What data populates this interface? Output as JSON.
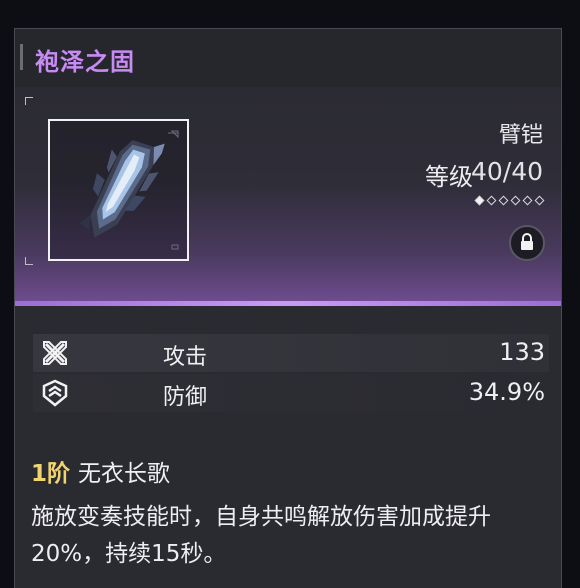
{
  "item": {
    "name": "袍泽之固",
    "type": "臂铠",
    "level_label": "等级",
    "level_value": "40/40",
    "rank_filled": 1,
    "rank_total": 6,
    "icon": "gauntlet-icon",
    "locked": true
  },
  "stats": [
    {
      "icon": "crossed-swords-icon",
      "name": "攻击",
      "value": "133"
    },
    {
      "icon": "shield-icon",
      "name": "防御",
      "value": "34.9%"
    }
  ],
  "passive": {
    "rank": "1阶",
    "name": "无衣长歌",
    "description": "施放变奏技能时，自身共鸣解放伤害加成提升20%，持续15秒。"
  },
  "colors": {
    "title": "#c78cf3",
    "accent_line": "#c99af5",
    "rank_gold": "#f1d470"
  }
}
